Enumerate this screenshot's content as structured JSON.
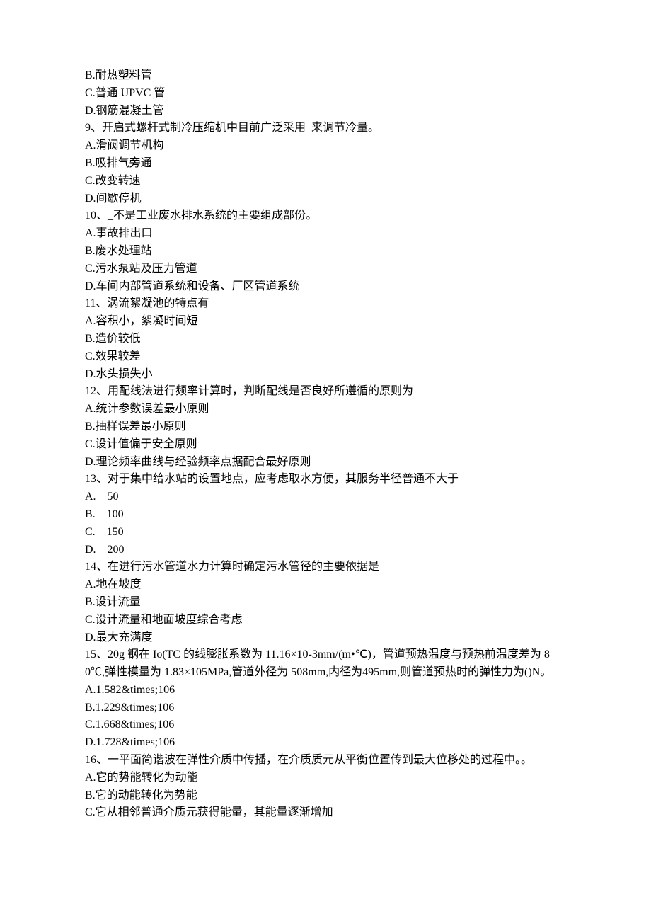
{
  "lines": [
    "B.耐热塑料管",
    "C.普通 UPVC 管",
    "D.钢筋混凝土管",
    "9、开启式螺杆式制冷压缩机中目前广泛采用_来调节冷量。",
    "A.滑阀调节机构",
    "B.吸排气旁通",
    "C.改变转速",
    "D.间歇停机",
    "10、_不是工业废水排水系统的主要组成部份。",
    "A.事故排出口",
    "B.废水处理站",
    "C.污水泵站及压力管道",
    "D.车间内部管道系统和设备、厂区管道系统",
    "11、涡流絮凝池的特点有",
    "A.容积小，絮凝时间短",
    "B.造价较低",
    "C.效果较差",
    "D.水头损失小",
    "12、用配线法进行频率计算时，判断配线是否良好所遵循的原则为",
    "A.统计参数误差最小原则",
    "B.抽样误差最小原则",
    "C.设计值偏于安全原则",
    "D.理论频率曲线与经验频率点据配合最好原则",
    "13、对于集中给水站的设置地点，应考虑取水方便，其服务半径普通不大于",
    "A.    50",
    "B.    100",
    "C.    150",
    "D.    200",
    "14、在进行污水管道水力计算时确定污水管径的主要依据是",
    "A.地在坡度",
    "B.设计流量",
    "C.设计流量和地面坡度综合考虑",
    "D.最大充满度",
    "15、20g 钢在 Io(TC 的线膨胀系数为 11.16×10-3mm/(m•℃)，管道预热温度与预热前温度差为 80℃,弹性模量为 1.83×105MPa,管道外径为 508mm,内径为495mm,则管道预热时的弹性力为()N。",
    "A.1.582&times;106",
    "B.1.229&times;106",
    "C.1.668&times;106",
    "D.1.728&times;106",
    "16、一平面简谐波在弹性介质中传播，在介质质元从平衡位置传到最大位移处的过程中。。",
    "A.它的势能转化为动能",
    "B.它的动能转化为势能",
    "C.它从相邻普通介质元获得能量，其能量逐渐增加"
  ]
}
